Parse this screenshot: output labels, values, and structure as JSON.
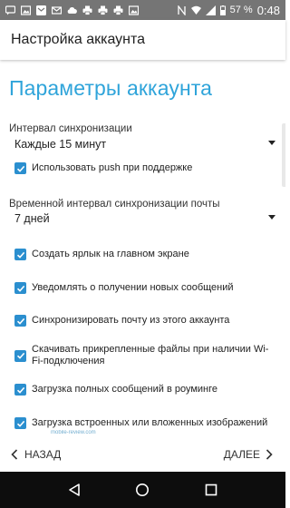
{
  "statusbar": {
    "battery": "57 %",
    "time": "0:48"
  },
  "toolbar": {
    "title": "Настройка аккаунта"
  },
  "main": {
    "heading": "Параметры аккаунта",
    "sync_interval": {
      "label": "Интервал синхронизации",
      "value": "Каждые 15 минут"
    },
    "push_checkbox": {
      "label": "Использовать push при поддержке",
      "checked": true
    },
    "mail_window": {
      "label": "Временной интервал синхронизации почты",
      "value": "7 дней"
    },
    "options": [
      {
        "label": "Создать ярлык на главном экране",
        "checked": true
      },
      {
        "label": "Уведомлять о получении новых сообщений",
        "checked": true
      },
      {
        "label": "Синхронизировать почту из этого аккаунта",
        "checked": true
      },
      {
        "label": "Скачивать прикрепленные файлы при наличии Wi-Fi-подключения",
        "checked": true
      },
      {
        "label": "Загрузка полных сообщений в роуминге",
        "checked": true
      },
      {
        "label": "Загрузка встроенных или вложенных изображений",
        "checked": true
      }
    ]
  },
  "footer": {
    "back_label": "НАЗАД",
    "next_label": "ДАЛЕЕ",
    "watermark": "mobile-review.com"
  },
  "colors": {
    "accent": "#2fa4da",
    "checkbox": "#2b8fcf",
    "statusbar": "#757575",
    "navbar": "#0d0d0d"
  },
  "icons": [
    "message-icon",
    "image-icon",
    "mail-icon",
    "gmail-icon",
    "cloud-icon",
    "print-icon",
    "nfc-icon",
    "wifi-icon",
    "signal-icon",
    "battery-icon",
    "chevron-left-icon",
    "chevron-right-icon",
    "back-triangle-icon",
    "home-circle-icon",
    "recents-square-icon"
  ]
}
